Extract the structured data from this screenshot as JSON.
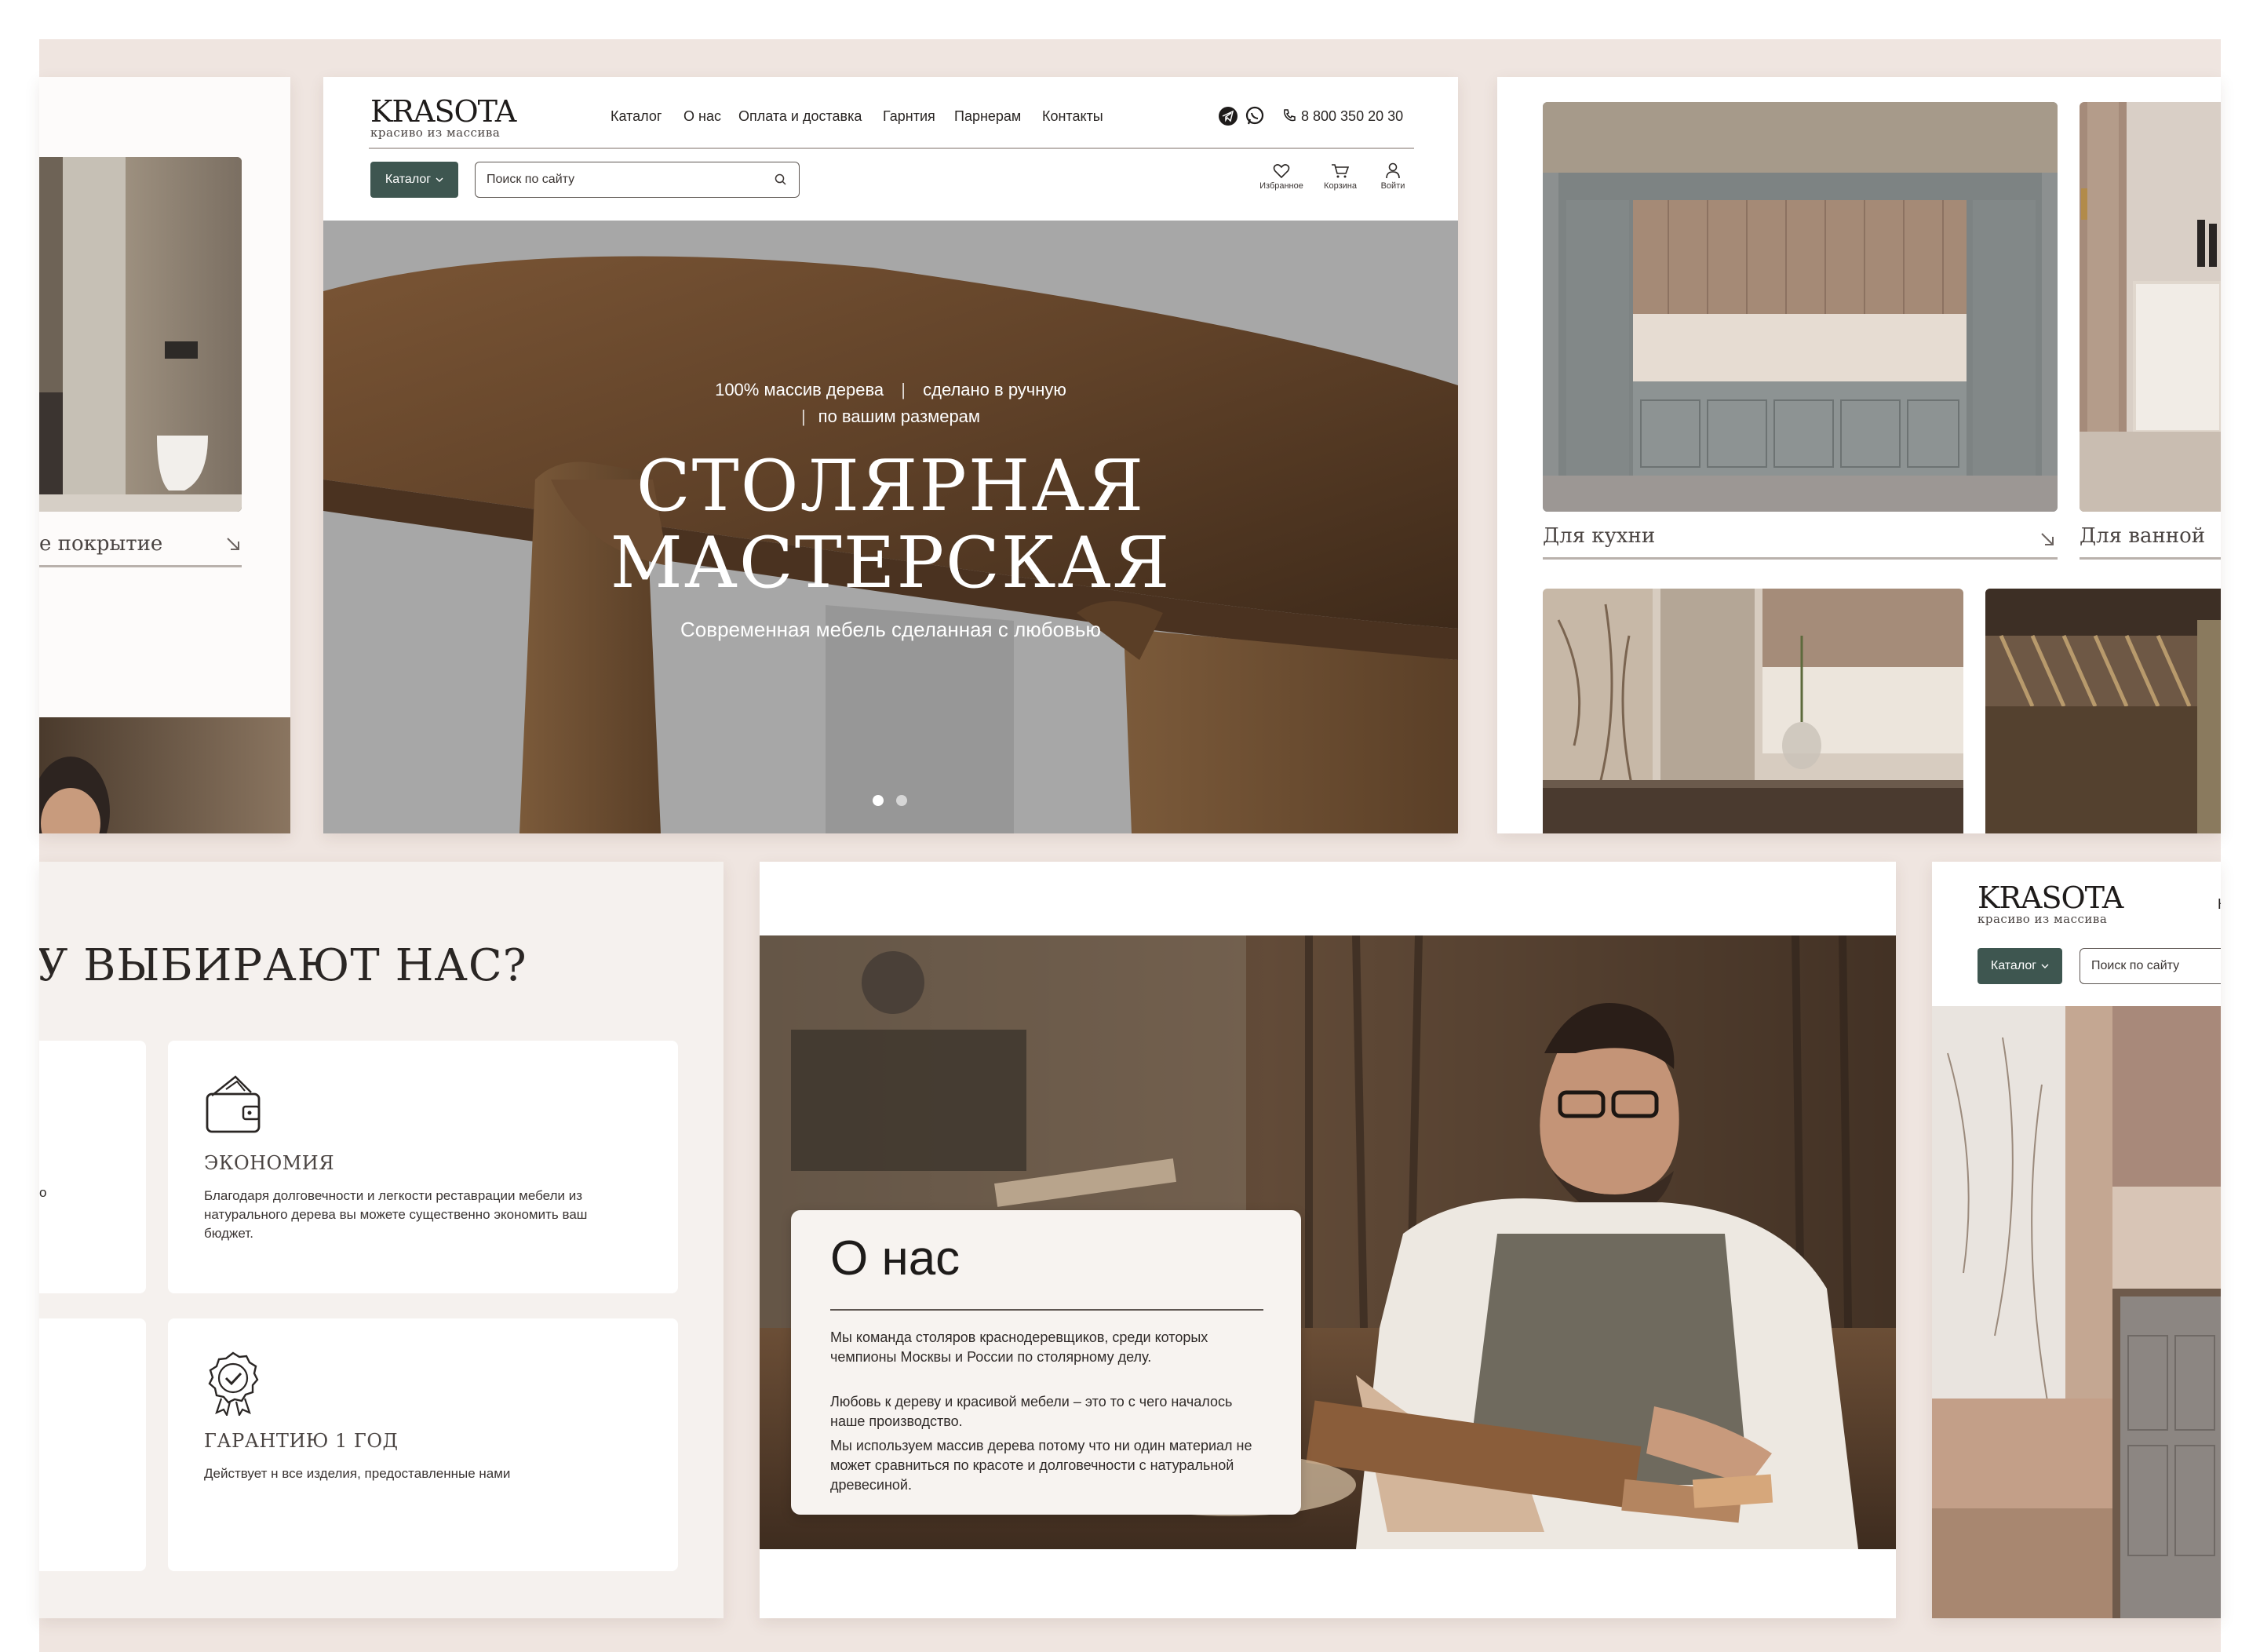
{
  "brand": {
    "name": "KRASOTA",
    "tagline": "красиво из массива"
  },
  "nav": [
    "Каталог",
    "О нас",
    "Оплата и доставка",
    "Гарнтия",
    "Парнерам",
    "Контакты"
  ],
  "header": {
    "phone": "8 800 350 20 30",
    "catalog_button": "Каталог",
    "search_placeholder": "Поиск по сайту",
    "favorites": "Избранное",
    "cart": "Корзина",
    "login": "Войти"
  },
  "hero": {
    "features_line1a": "100% массив дерева",
    "features_line1b": "сделано в ручную",
    "features_line2": "по вашим размерам",
    "title_line1": "СТОЛЯРНАЯ",
    "title_line2": "МАСТЕРСКАЯ",
    "subtitle": "Современная мебель сделанная с любовью",
    "slides": 2,
    "active_slide": 1
  },
  "gallery": {
    "kitchen_label": "Для кухни",
    "bathroom_label": "Для ванной",
    "left_partial_label": "е покрытие"
  },
  "features": {
    "heading": "У ВЫБИРАЮТ НАС?",
    "cards": [
      {
        "title": "ЭКОНОМИЯ",
        "text": "Благодаря долговечности и легкости реставрации мебели из натурального дерева вы можете существенно экономить ваш бюджет.",
        "icon": "wallet-icon"
      },
      {
        "title": "ГАРАНТИЮ 1 ГОД",
        "text": "Действует н все изделия, предоставленные нами",
        "icon": "award-badge-icon"
      }
    ],
    "partial_left_text": "о"
  },
  "about": {
    "title": "О нас",
    "paragraphs": [
      "Мы команда столяров краснодеревщиков, среди которых чемпионы Москвы и России по столярному делу.",
      "Любовь к дереву и красивой мебели – это то с чего началось наше производство.",
      "Мы используем  массив дерева потому что ни один материал не может сравниться по красоте и долговечности с натуральной древесиной."
    ]
  },
  "right_partial": {
    "catalog_button": "Каталог",
    "search_placeholder": "Поиск по сайту",
    "nav_partial": "Ка"
  },
  "colors": {
    "accent": "#3e5650",
    "page_bg": "#efe5e0",
    "text": "#2a2624"
  }
}
